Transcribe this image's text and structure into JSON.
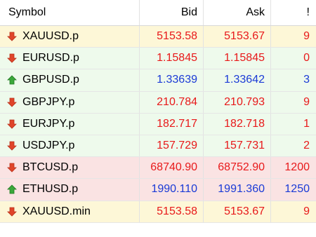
{
  "header": {
    "symbol": "Symbol",
    "bid": "Bid",
    "ask": "Ask",
    "spread": "!"
  },
  "colors": {
    "down": "#e8191a",
    "up": "#1a3ad6",
    "row_yellow": "#fdf7d7",
    "row_green": "#eefaec",
    "row_pink": "#fae3e3"
  },
  "rows": [
    {
      "symbol": "XAUUSD.p",
      "bid": "5153.58",
      "ask": "5153.67",
      "spread": "9",
      "dir": "down",
      "bg": "row_yellow"
    },
    {
      "symbol": "EURUSD.p",
      "bid": "1.15845",
      "ask": "1.15845",
      "spread": "0",
      "dir": "down",
      "bg": "row_green"
    },
    {
      "symbol": "GBPUSD.p",
      "bid": "1.33639",
      "ask": "1.33642",
      "spread": "3",
      "dir": "up",
      "bg": "row_green"
    },
    {
      "symbol": "GBPJPY.p",
      "bid": "210.784",
      "ask": "210.793",
      "spread": "9",
      "dir": "down",
      "bg": "row_green"
    },
    {
      "symbol": "EURJPY.p",
      "bid": "182.717",
      "ask": "182.718",
      "spread": "1",
      "dir": "down",
      "bg": "row_green"
    },
    {
      "symbol": "USDJPY.p",
      "bid": "157.729",
      "ask": "157.731",
      "spread": "2",
      "dir": "down",
      "bg": "row_green"
    },
    {
      "symbol": "BTCUSD.p",
      "bid": "68740.90",
      "ask": "68752.90",
      "spread": "1200",
      "dir": "down",
      "bg": "row_pink"
    },
    {
      "symbol": "ETHUSD.p",
      "bid": "1990.110",
      "ask": "1991.360",
      "spread": "1250",
      "dir": "up",
      "bg": "row_pink"
    },
    {
      "symbol": "XAUUSD.min",
      "bid": "5153.58",
      "ask": "5153.67",
      "spread": "9",
      "dir": "down",
      "bg": "row_yellow"
    }
  ]
}
